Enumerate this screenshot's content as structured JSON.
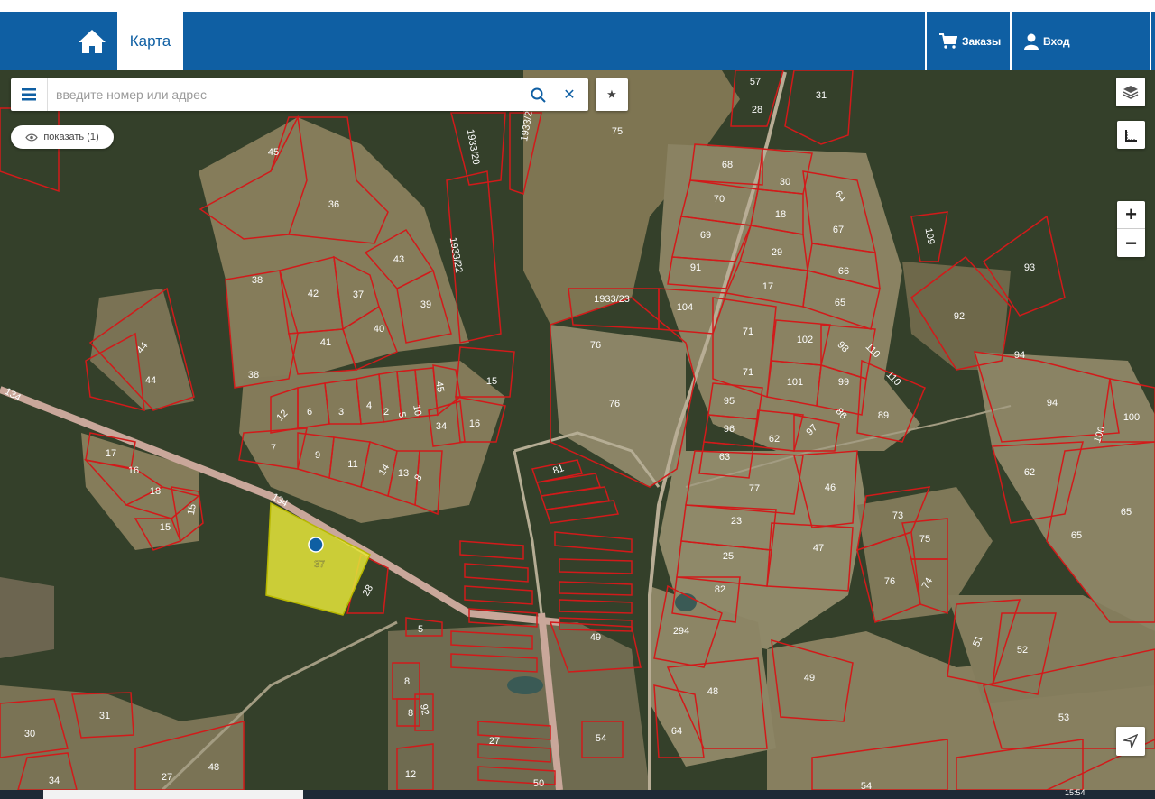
{
  "header": {
    "home_icon": "home-icon",
    "tab_label": "Карта",
    "orders_label": "Заказы",
    "login_label": "Вход",
    "colors": {
      "header_bg": "#0f5fa3",
      "parcel_border": "#d21a1a",
      "selected_fill": "#e6e63a"
    }
  },
  "search": {
    "placeholder": "введите номер или адрес",
    "value": ""
  },
  "show_button": {
    "label": "показать (1)"
  },
  "map_controls": {
    "layers_icon": "layers-icon",
    "ruler_icon": "ruler-icon",
    "zoom_in": "+",
    "zoom_out": "−",
    "locate_icon": "locate-icon"
  },
  "parcels": [
    {
      "label": "57"
    },
    {
      "label": "31"
    },
    {
      "label": "28"
    },
    {
      "label": "45"
    },
    {
      "label": "1933/20"
    },
    {
      "label": "1933/2"
    },
    {
      "label": "75"
    },
    {
      "label": "68"
    },
    {
      "label": "30"
    },
    {
      "label": "64"
    },
    {
      "label": "36"
    },
    {
      "label": "70"
    },
    {
      "label": "18"
    },
    {
      "label": "67"
    },
    {
      "label": "109"
    },
    {
      "label": "69"
    },
    {
      "label": "29"
    },
    {
      "label": "93"
    },
    {
      "label": "1933/22"
    },
    {
      "label": "43"
    },
    {
      "label": "91"
    },
    {
      "label": "66"
    },
    {
      "label": "38"
    },
    {
      "label": "42"
    },
    {
      "label": "37"
    },
    {
      "label": "39"
    },
    {
      "label": "17"
    },
    {
      "label": "1933/23"
    },
    {
      "label": "104"
    },
    {
      "label": "65"
    },
    {
      "label": "92"
    },
    {
      "label": "40"
    },
    {
      "label": "41"
    },
    {
      "label": "71"
    },
    {
      "label": "102"
    },
    {
      "label": "98"
    },
    {
      "label": "110"
    },
    {
      "label": "44"
    },
    {
      "label": "76"
    },
    {
      "label": "94"
    },
    {
      "label": "38"
    },
    {
      "label": "44"
    },
    {
      "label": "15"
    },
    {
      "label": "71"
    },
    {
      "label": "101"
    },
    {
      "label": "99"
    },
    {
      "label": "110"
    },
    {
      "label": "134"
    },
    {
      "label": "6"
    },
    {
      "label": "3"
    },
    {
      "label": "4"
    },
    {
      "label": "2"
    },
    {
      "label": "5"
    },
    {
      "label": "10"
    },
    {
      "label": "45"
    },
    {
      "label": "12"
    },
    {
      "label": "76"
    },
    {
      "label": "95"
    },
    {
      "label": "86"
    },
    {
      "label": "89"
    },
    {
      "label": "94"
    },
    {
      "label": "100"
    },
    {
      "label": "34"
    },
    {
      "label": "16"
    },
    {
      "label": "96"
    },
    {
      "label": "62"
    },
    {
      "label": "97"
    },
    {
      "label": "7"
    },
    {
      "label": "9"
    },
    {
      "label": "17"
    },
    {
      "label": "11"
    },
    {
      "label": "14"
    },
    {
      "label": "13"
    },
    {
      "label": "8"
    },
    {
      "label": "63"
    },
    {
      "label": "100"
    },
    {
      "label": "62"
    },
    {
      "label": "16"
    },
    {
      "label": "81"
    },
    {
      "label": "77"
    },
    {
      "label": "46"
    },
    {
      "label": "18"
    },
    {
      "label": "134"
    },
    {
      "label": "15"
    },
    {
      "label": "73"
    },
    {
      "label": "65"
    },
    {
      "label": "15"
    },
    {
      "label": "23"
    },
    {
      "label": "65"
    },
    {
      "label": "75"
    },
    {
      "label": "47"
    },
    {
      "label": "25"
    },
    {
      "label": "76"
    },
    {
      "label": "74"
    },
    {
      "label": "82"
    },
    {
      "label": "28"
    },
    {
      "label": "294"
    },
    {
      "label": "51"
    },
    {
      "label": "52"
    },
    {
      "label": "5"
    },
    {
      "label": "49"
    },
    {
      "label": "49"
    },
    {
      "label": "8"
    },
    {
      "label": "48"
    },
    {
      "label": "92"
    },
    {
      "label": "8"
    },
    {
      "label": "31"
    },
    {
      "label": "53"
    },
    {
      "label": "30"
    },
    {
      "label": "64"
    },
    {
      "label": "54"
    },
    {
      "label": "27"
    },
    {
      "label": "34"
    },
    {
      "label": "27"
    },
    {
      "label": "48"
    },
    {
      "label": "12"
    },
    {
      "label": "50"
    },
    {
      "label": "54"
    }
  ],
  "selected_parcel": {
    "label": "37"
  },
  "taskbar": {
    "time": "15:54"
  }
}
